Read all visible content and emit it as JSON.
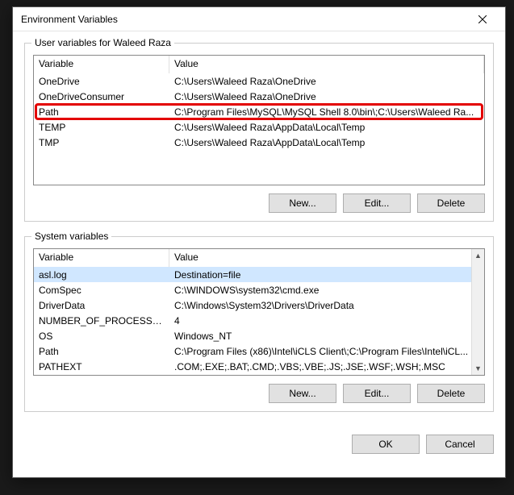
{
  "dialog": {
    "title": "Environment Variables"
  },
  "userVars": {
    "legend": "User variables for Waleed Raza",
    "header": {
      "variable": "Variable",
      "value": "Value"
    },
    "rows": [
      {
        "variable": "OneDrive",
        "value": "C:\\Users\\Waleed Raza\\OneDrive"
      },
      {
        "variable": "OneDriveConsumer",
        "value": "C:\\Users\\Waleed Raza\\OneDrive"
      },
      {
        "variable": "Path",
        "value": "C:\\Program Files\\MySQL\\MySQL Shell 8.0\\bin\\;C:\\Users\\Waleed Ra..."
      },
      {
        "variable": "TEMP",
        "value": "C:\\Users\\Waleed Raza\\AppData\\Local\\Temp"
      },
      {
        "variable": "TMP",
        "value": "C:\\Users\\Waleed Raza\\AppData\\Local\\Temp"
      }
    ],
    "highlightedRowIndex": 2,
    "buttons": {
      "new": "New...",
      "edit": "Edit...",
      "delete": "Delete"
    }
  },
  "systemVars": {
    "legend": "System variables",
    "header": {
      "variable": "Variable",
      "value": "Value"
    },
    "rows": [
      {
        "variable": "asl.log",
        "value": "Destination=file"
      },
      {
        "variable": "ComSpec",
        "value": "C:\\WINDOWS\\system32\\cmd.exe"
      },
      {
        "variable": "DriverData",
        "value": "C:\\Windows\\System32\\Drivers\\DriverData"
      },
      {
        "variable": "NUMBER_OF_PROCESSORS",
        "value": "4"
      },
      {
        "variable": "OS",
        "value": "Windows_NT"
      },
      {
        "variable": "Path",
        "value": "C:\\Program Files (x86)\\Intel\\iCLS Client\\;C:\\Program Files\\Intel\\iCL..."
      },
      {
        "variable": "PATHEXT",
        "value": ".COM;.EXE;.BAT;.CMD;.VBS;.VBE;.JS;.JSE;.WSF;.WSH;.MSC"
      }
    ],
    "selectedRowIndex": 0,
    "buttons": {
      "new": "New...",
      "edit": "Edit...",
      "delete": "Delete"
    }
  },
  "footer": {
    "ok": "OK",
    "cancel": "Cancel"
  }
}
